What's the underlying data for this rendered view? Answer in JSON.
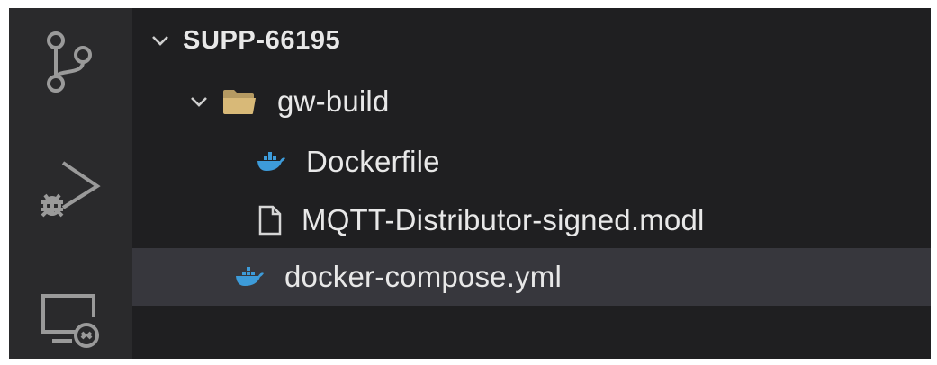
{
  "explorer": {
    "root": {
      "label": "SUPP-66195",
      "expanded": true
    },
    "folder": {
      "label": "gw-build",
      "expanded": true,
      "icon": "folder-icon"
    },
    "files": [
      {
        "label": "Dockerfile",
        "icon": "docker-icon"
      },
      {
        "label": "MQTT-Distributor-signed.modl",
        "icon": "file-icon"
      }
    ],
    "root_file": {
      "label": "docker-compose.yml",
      "icon": "docker-icon",
      "selected": true
    }
  },
  "activity_bar": [
    "source-control-icon",
    "run-debug-icon",
    "remote-explorer-icon"
  ],
  "colors": {
    "explorer_bg": "#1f1f21",
    "activity_bg": "#2a2a2c",
    "selected_row": "#37373d",
    "text": "#e8e8e8",
    "docker_blue": "#3d9bd9",
    "folder_tan": "#d8b978"
  }
}
